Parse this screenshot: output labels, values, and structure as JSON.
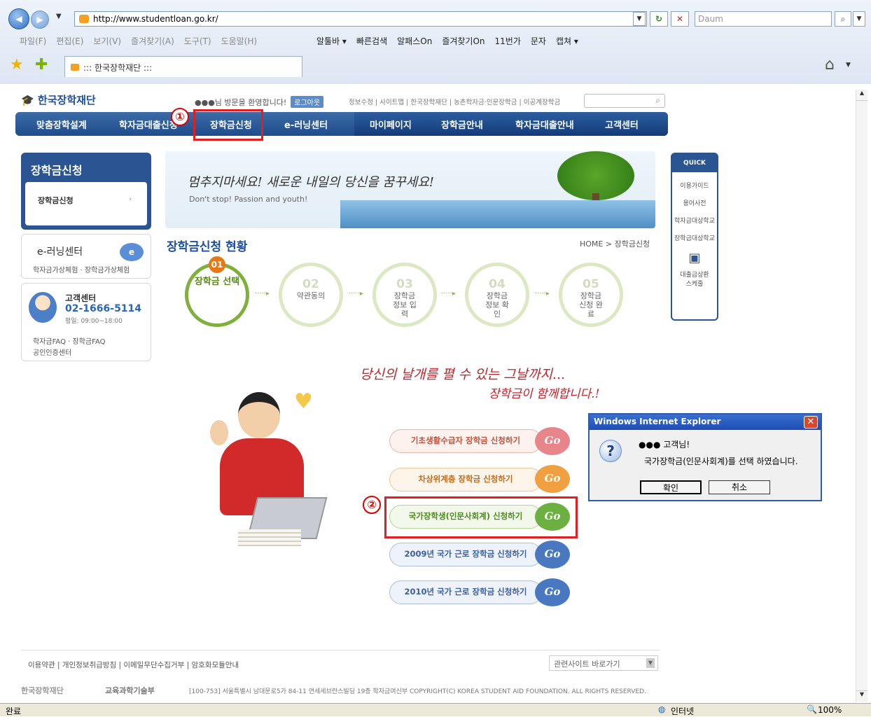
{
  "browser": {
    "url": "http://www.studentloan.go.kr/",
    "search_placeholder": "Daum",
    "menu": [
      "파일(F)",
      "편집(E)",
      "보기(V)",
      "즐겨찾기(A)",
      "도구(T)",
      "도움말(H)"
    ],
    "toolbar": [
      "알툴바 ▾",
      "빠른검색",
      "알패스On",
      "즐겨찾기On",
      "11번가",
      "문자",
      "캡쳐 ▾"
    ],
    "tab_title": "::: 한국장학재단 :::",
    "status_left": "완료",
    "status_zone": "인터넷",
    "zoom": "100%"
  },
  "site": {
    "logo": "한국장학재단",
    "welcome": "●●●님 방문을 환영합니다!",
    "logout": "로그아웃",
    "top_links": "정보수정 | 사이트맵 | 한국장학재단 | 농촌학자금·인문장학금 | 이공계장학금",
    "gnb": [
      "맞춤장학설계",
      "학자금대출신청",
      "장학금신청",
      "e-러닝센터",
      "마이페이지",
      "장학금안내",
      "학자금대출안내",
      "고객센터"
    ]
  },
  "annotations": {
    "one": "①",
    "two": "②"
  },
  "sidebar": {
    "title": "장학금신청",
    "item": "장학금신청",
    "elearning": "e-러닝센터",
    "elearning_links": "학자금가상체험 · 장학금가상체험",
    "cs_title": "고객센터",
    "cs_phone": "02-1666-5114",
    "cs_hours": "평일: 09:00~18:00",
    "cs_links1": "학자금FAQ · 장학금FAQ",
    "cs_links2": "공인인증센터"
  },
  "banner": {
    "script": "멈추지마세요! 새로운 내일의 당신을 꿈꾸세요!",
    "sub": "Don't stop! Passion and youth!"
  },
  "main": {
    "title": "장학금신청 현황",
    "breadcrumb": "HOME > 장학금신청",
    "steps": [
      {
        "num": "01",
        "label": "장학금 선택"
      },
      {
        "num": "02",
        "label": "약관동의"
      },
      {
        "num": "03",
        "label": "장학금 정보 입 력"
      },
      {
        "num": "04",
        "label": "장학금 정보 확 인"
      },
      {
        "num": "05",
        "label": "장학금 신청 완 료"
      }
    ],
    "slogan1": "당신의 날개를 펼 수 있는 그날까지...",
    "slogan2": "장학금이 함께합니다.!",
    "buttons": [
      "기초생활수급자 장학금 신청하기",
      "차상위계층 장학금 신청하기",
      "국가장학생(인문사회계) 신청하기",
      "2009년 국가 근로 장학금 신청하기",
      "2010년 국가 근로 장학금 신청하기"
    ],
    "go": "Go"
  },
  "quick_menu": {
    "title": "QUICK MENU",
    "items": [
      "이용가이드",
      "용어사전",
      "학자금대상학교",
      "장학금대상학교",
      "대출금상환 스케줄"
    ]
  },
  "dialog": {
    "title": "Windows Internet Explorer",
    "line1": "●●● 고객님!",
    "line2": "국가장학금(인문사회계)를 선택 하였습니다.",
    "ok": "확인",
    "cancel": "취소"
  },
  "footer": {
    "links": "이용약관 | 개인정보취급방침 | 이메일무단수집거부 | 암호화모듈안내",
    "related": "관련사이트 바로가기",
    "address": "[100-753] 서울특별시 남대문로5가 84-11 연세세브란스빌딩 19층 학자금여신부   COPYRIGHT(C) KOREA STUDENT AID FOUNDATION. ALL RIGHTS RESERVED.",
    "logo2": "교육과학기술부"
  }
}
